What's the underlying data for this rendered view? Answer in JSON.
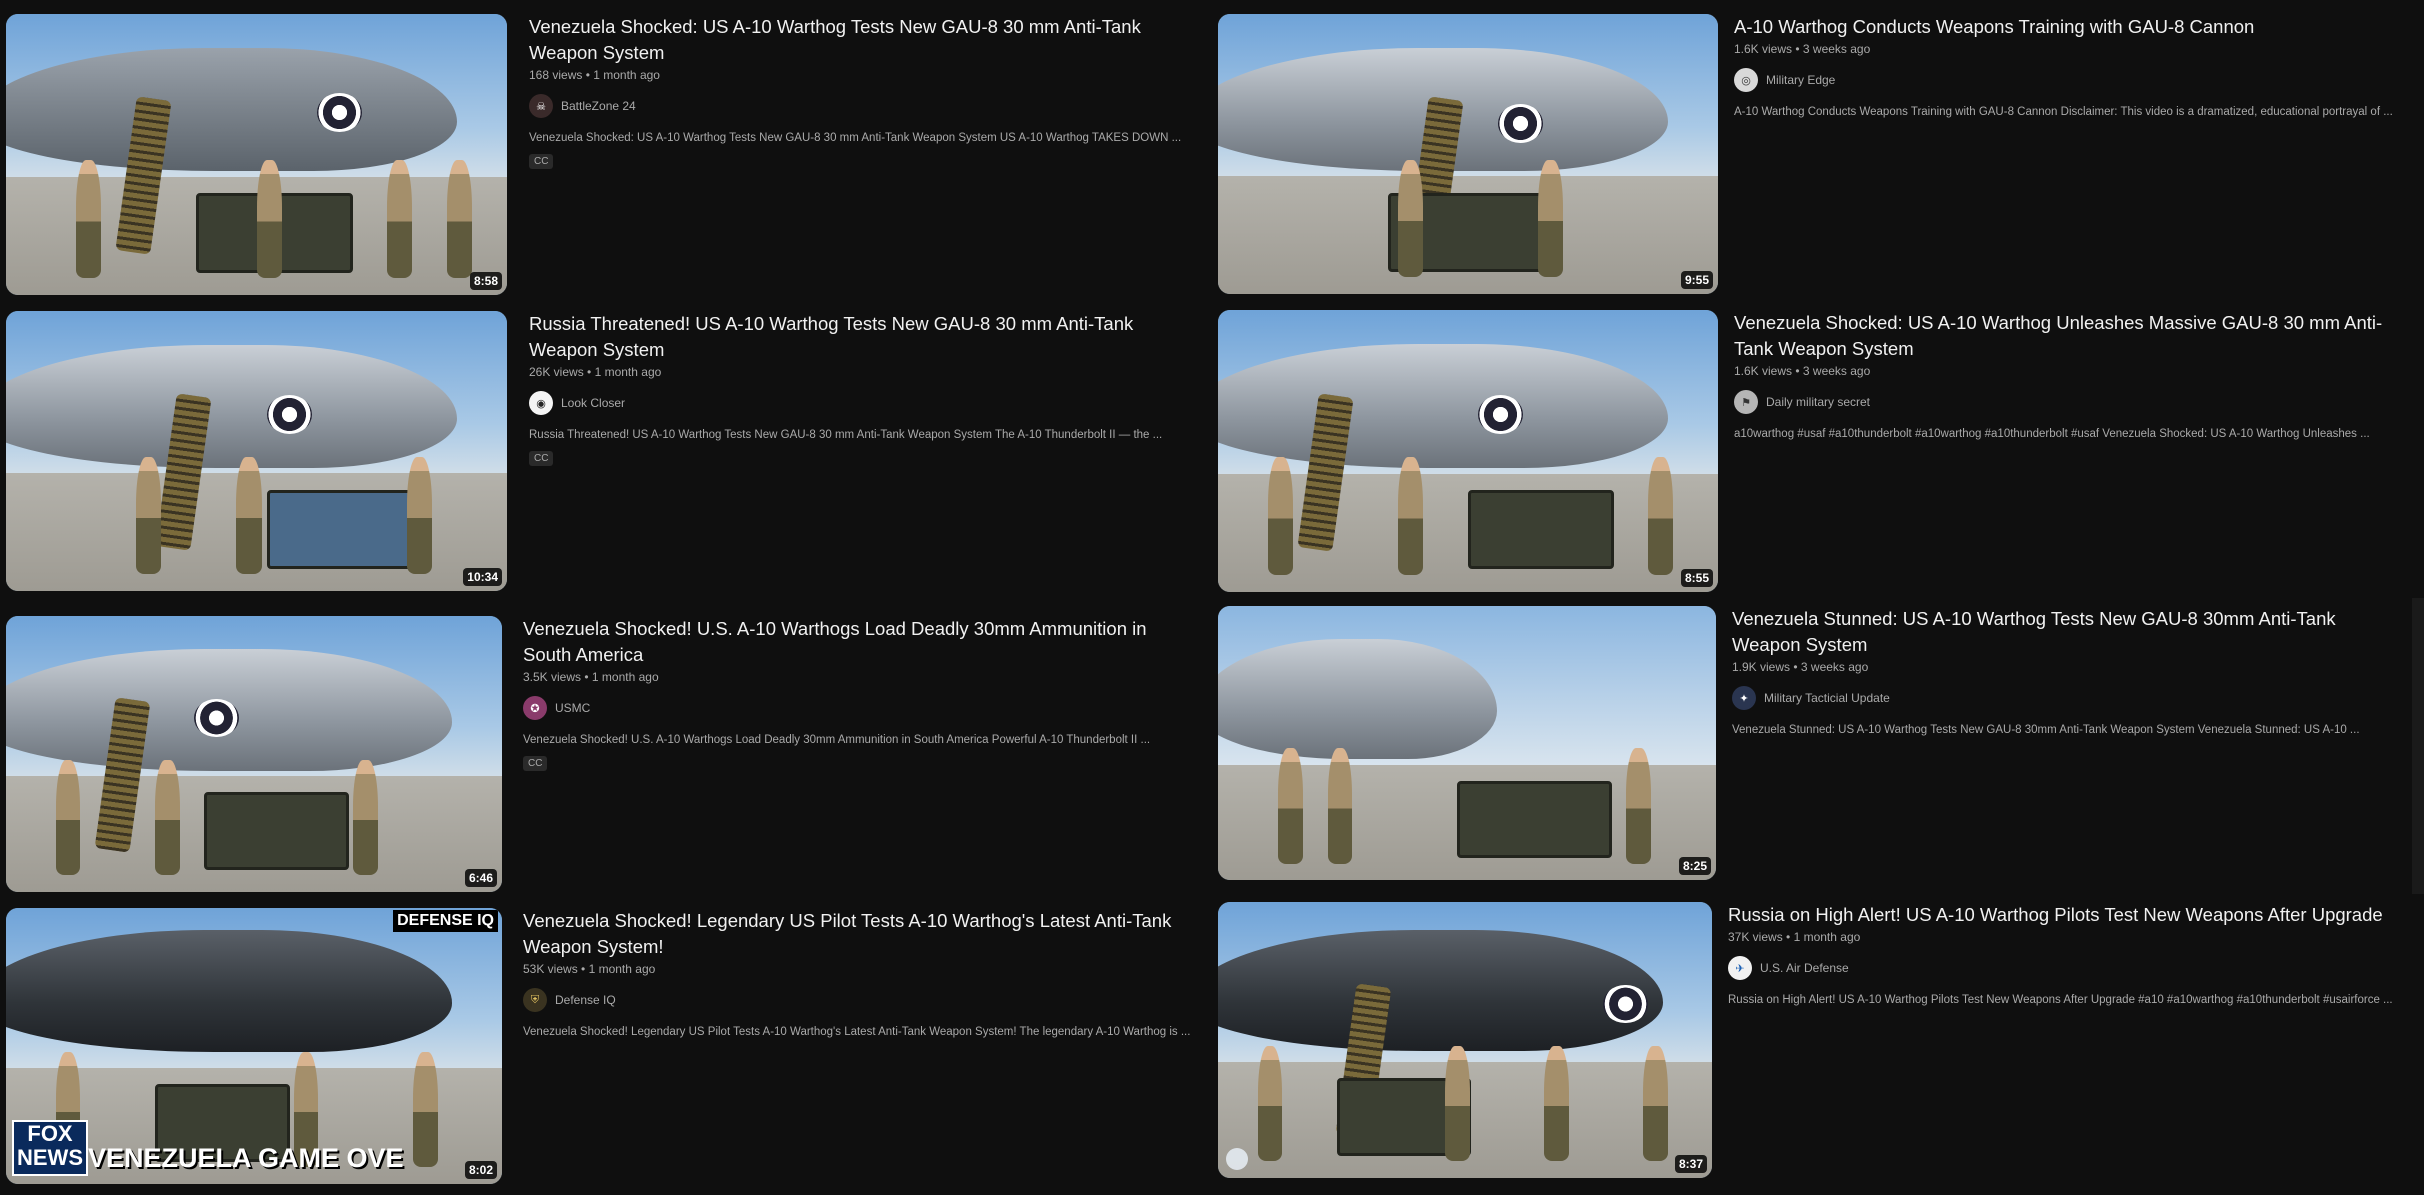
{
  "videos": [
    {
      "title": "Venezuela Shocked: US A-10 Warthog Tests New GAU-8 30 mm Anti-Tank Weapon System",
      "views": "168 views",
      "age": "1 month ago",
      "channel": "BattleZone 24",
      "description": "Venezuela Shocked: US A-10 Warthog Tests New GAU-8 30 mm Anti-Tank Weapon System US A-10 Warthog TAKES DOWN ...",
      "duration": "8:58",
      "badge": "CC",
      "channel_icon": "skull-icon"
    },
    {
      "title": "A-10 Warthog Conducts Weapons Training with GAU-8 Cannon",
      "views": "1.6K views",
      "age": "3 weeks ago",
      "channel": "Military Edge",
      "description": "A-10 Warthog Conducts Weapons Training with GAU-8 Cannon Disclaimer: This video is a dramatized, educational portrayal of ...",
      "duration": "9:55",
      "channel_icon": "globe-icon"
    },
    {
      "title": "Russia Threatened! US A-10 Warthog Tests New GAU-8 30 mm Anti-Tank Weapon System",
      "views": "26K views",
      "age": "1 month ago",
      "channel": "Look Closer",
      "description": "Russia Threatened! US A-10 Warthog Tests New GAU-8 30 mm Anti-Tank Weapon System The A-10 Thunderbolt II — the ...",
      "duration": "10:34",
      "badge": "CC",
      "channel_icon": "eye-icon"
    },
    {
      "title": "Venezuela Shocked: US A-10 Warthog Unleashes Massive GAU-8 30 mm Anti-Tank Weapon System",
      "views": "1.6K views",
      "age": "3 weeks ago",
      "channel": "Daily military secret",
      "description": "a10warthog #usaf #a10thunderbolt #a10warthog #a10thunderbolt #usaf Venezuela Shocked: US A-10 Warthog Unleashes ...",
      "duration": "8:55",
      "channel_icon": "flag-icon"
    },
    {
      "title": "Venezuela Shocked! U.S. A-10 Warthogs Load Deadly 30mm Ammunition in South America",
      "views": "3.5K views",
      "age": "1 month ago",
      "channel": "USMC",
      "description": "Venezuela Shocked! U.S. A-10 Warthogs Load Deadly 30mm Ammunition in South America Powerful A-10 Thunderbolt II ...",
      "duration": "6:46",
      "badge": "CC",
      "channel_icon": "emblem-icon"
    },
    {
      "title": "Venezuela Stunned: US A-10 Warthog Tests New GAU-8 30mm Anti-Tank Weapon System",
      "views": "1.9K views",
      "age": "3 weeks ago",
      "channel": "Military Tacticial Update",
      "description": "Venezuela Stunned: US A-10 Warthog Tests New GAU-8 30mm Anti-Tank Weapon System Venezuela Stunned: US A-10 ...",
      "duration": "8:25",
      "channel_icon": "badge-icon"
    },
    {
      "title": "Venezuela Shocked! Legendary US Pilot Tests A-10 Warthog's Latest Anti-Tank Weapon System!",
      "views": "53K views",
      "age": "1 month ago",
      "channel": "Defense IQ",
      "description": "Venezuela Shocked! Legendary US Pilot Tests A-10 Warthog's Latest Anti-Tank Weapon System! The legendary A-10 Warthog is ...",
      "duration": "8:02",
      "channel_icon": "shield-icon",
      "thumb_corner": "DEFENSE IQ",
      "thumb_banner": "VENEZUELA GAME OVE",
      "thumb_logo": "FOX NEWS"
    },
    {
      "title": "Russia on High Alert! US A-10 Warthog Pilots Test New Weapons After Upgrade",
      "views": "37K views",
      "age": "1 month ago",
      "channel": "U.S. Air Defense",
      "description": "Russia on High Alert! US A-10 Warthog Pilots Test New Weapons After Upgrade #a10 #a10warthog #a10thunderbolt #usairforce ...",
      "duration": "8:37",
      "channel_icon": "jet-icon"
    }
  ]
}
